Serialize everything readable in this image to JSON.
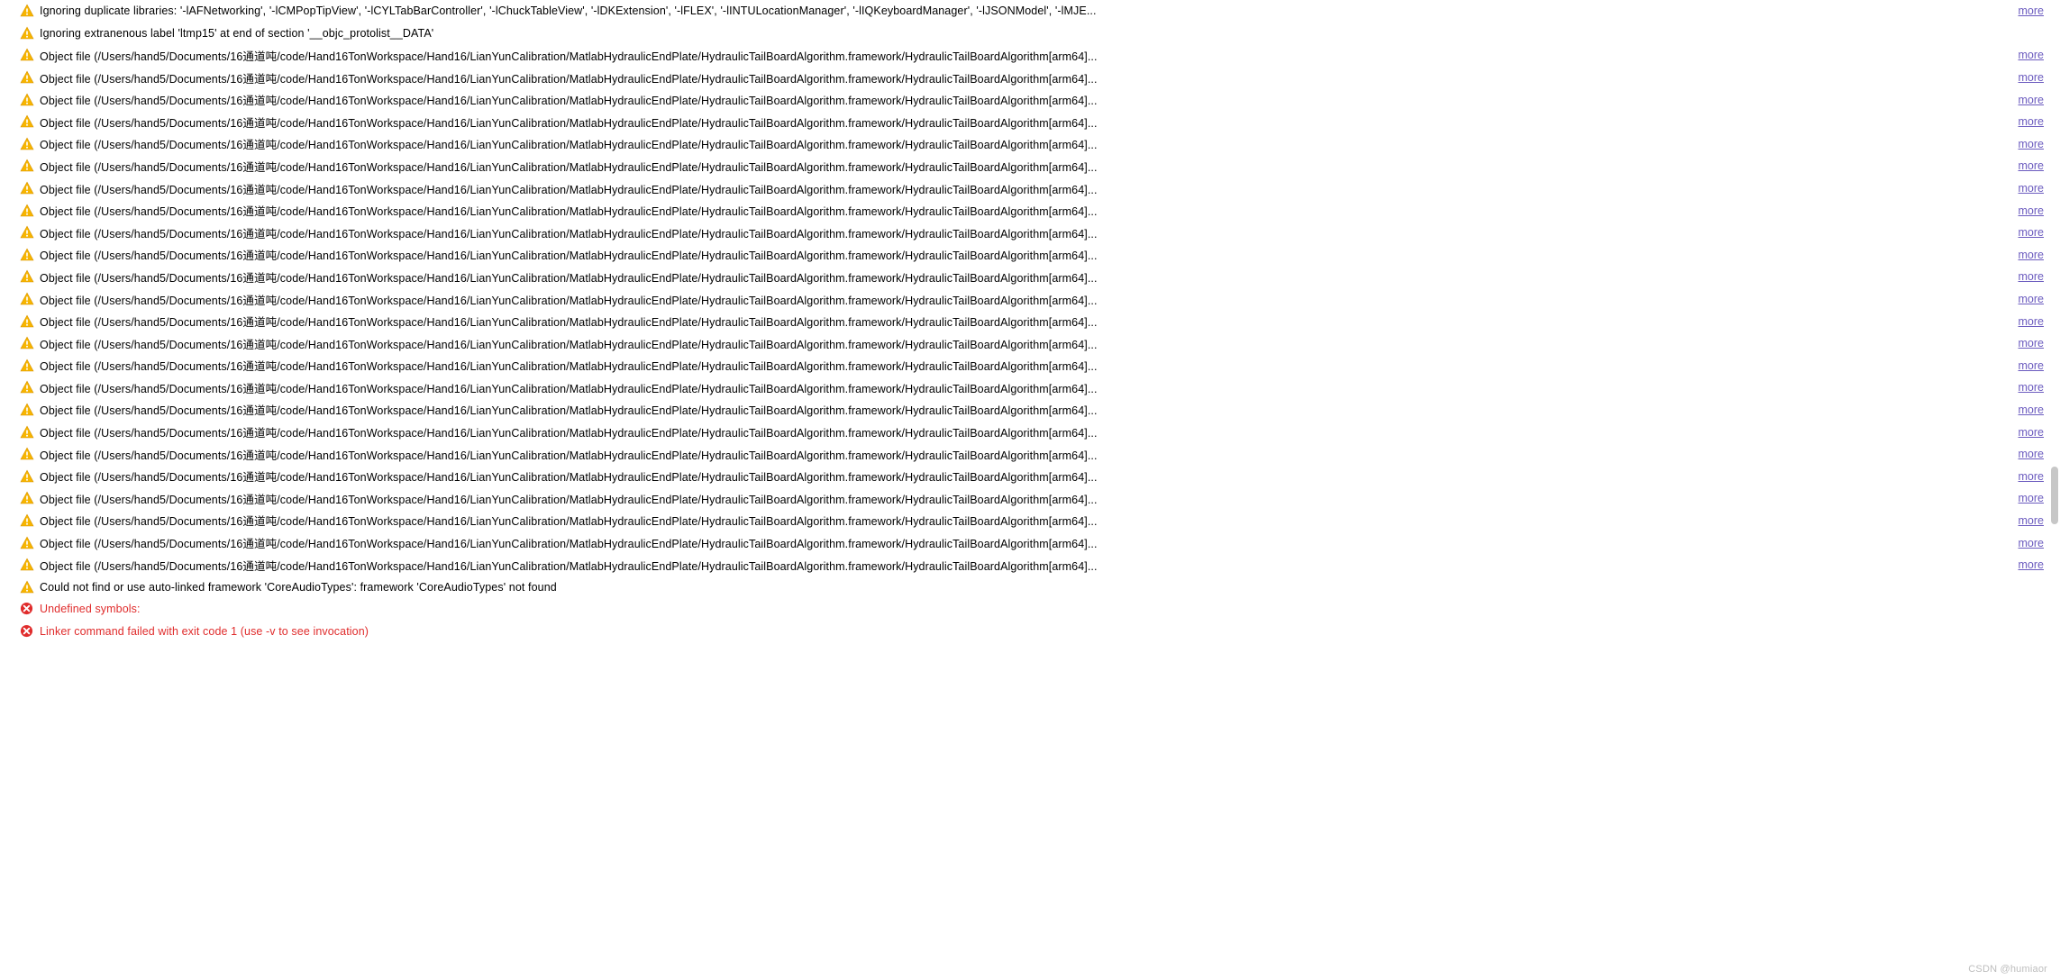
{
  "more_label": "more",
  "watermark": "CSDN @humiaor",
  "object_file_msg": "Object file (/Users/hand5/Documents/16通道吨/code/Hand16TonWorkspace/Hand16/LianYunCalibration/MatlabHydraulicEndPlate/HydraulicTailBoardAlgorithm.framework/HydraulicTailBoardAlgorithm[arm64]...",
  "rows": [
    {
      "type": "warning",
      "msg": "Ignoring duplicate libraries: '-lAFNetworking', '-lCMPopTipView', '-lCYLTabBarController', '-lChuckTableView', '-lDKExtension', '-lFLEX', '-lINTULocationManager', '-lIQKeyboardManager', '-lJSONModel', '-lMJE...",
      "more": true
    },
    {
      "type": "warning",
      "msg": "Ignoring extranenous label 'ltmp15' at end of section '__objc_protolist__DATA'",
      "more": false
    },
    {
      "type": "warning",
      "msg_ref": "object_file_msg",
      "more": true
    },
    {
      "type": "warning",
      "msg_ref": "object_file_msg",
      "more": true
    },
    {
      "type": "warning",
      "msg_ref": "object_file_msg",
      "more": true
    },
    {
      "type": "warning",
      "msg_ref": "object_file_msg",
      "more": true
    },
    {
      "type": "warning",
      "msg_ref": "object_file_msg",
      "more": true
    },
    {
      "type": "warning",
      "msg_ref": "object_file_msg",
      "more": true
    },
    {
      "type": "warning",
      "msg_ref": "object_file_msg",
      "more": true
    },
    {
      "type": "warning",
      "msg_ref": "object_file_msg",
      "more": true
    },
    {
      "type": "warning",
      "msg_ref": "object_file_msg",
      "more": true
    },
    {
      "type": "warning",
      "msg_ref": "object_file_msg",
      "more": true
    },
    {
      "type": "warning",
      "msg_ref": "object_file_msg",
      "more": true
    },
    {
      "type": "warning",
      "msg_ref": "object_file_msg",
      "more": true
    },
    {
      "type": "warning",
      "msg_ref": "object_file_msg",
      "more": true
    },
    {
      "type": "warning",
      "msg_ref": "object_file_msg",
      "more": true
    },
    {
      "type": "warning",
      "msg_ref": "object_file_msg",
      "more": true
    },
    {
      "type": "warning",
      "msg_ref": "object_file_msg",
      "more": true
    },
    {
      "type": "warning",
      "msg_ref": "object_file_msg",
      "more": true
    },
    {
      "type": "warning",
      "msg_ref": "object_file_msg",
      "more": true
    },
    {
      "type": "warning",
      "msg_ref": "object_file_msg",
      "more": true
    },
    {
      "type": "warning",
      "msg_ref": "object_file_msg",
      "more": true
    },
    {
      "type": "warning",
      "msg_ref": "object_file_msg",
      "more": true
    },
    {
      "type": "warning",
      "msg_ref": "object_file_msg",
      "more": true
    },
    {
      "type": "warning",
      "msg_ref": "object_file_msg",
      "more": true
    },
    {
      "type": "warning",
      "msg_ref": "object_file_msg",
      "more": true
    },
    {
      "type": "warning",
      "msg": "Could not find or use auto-linked framework 'CoreAudioTypes': framework 'CoreAudioTypes' not found",
      "more": false
    },
    {
      "type": "error",
      "msg": "Undefined symbols:",
      "more": false
    },
    {
      "type": "error",
      "msg": "Linker command failed with exit code 1 (use -v to see invocation)",
      "more": false
    }
  ]
}
